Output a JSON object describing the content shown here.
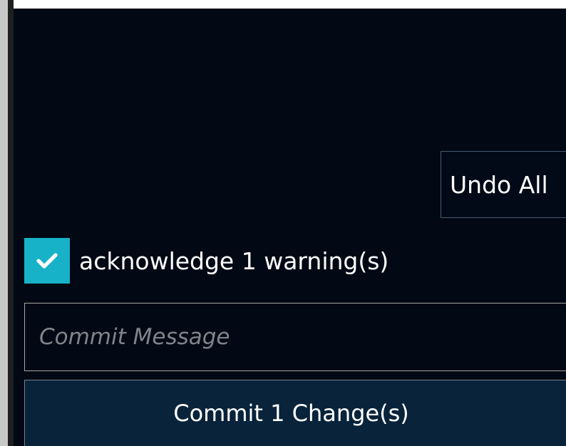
{
  "panel": {
    "undo_all_label": "Undo All",
    "acknowledge": {
      "checked": true,
      "label": "acknowledge 1 warning(s)",
      "icon": "checkmark-icon"
    },
    "commit_message": {
      "value": "",
      "placeholder": "Commit Message"
    },
    "commit_button_label": "Commit 1 Change(s)"
  },
  "colors": {
    "panel_background": "#030914",
    "checkbox_accent": "#17b2c8",
    "commit_button_background": "#08233a",
    "text": "#ffffff",
    "placeholder": "#7f858b"
  }
}
